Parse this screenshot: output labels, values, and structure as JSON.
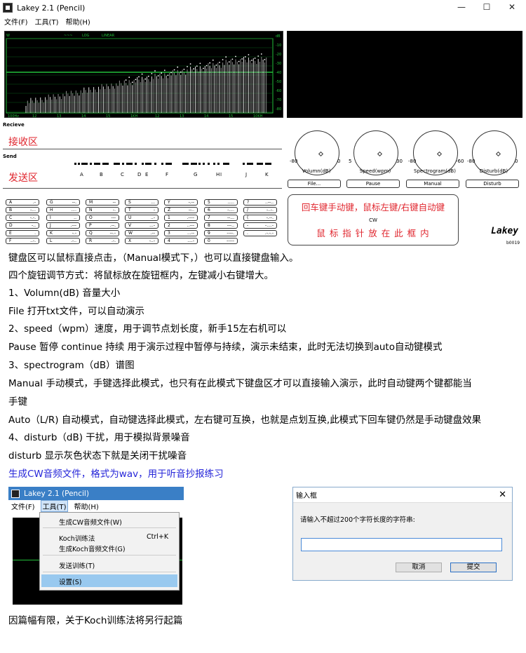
{
  "window": {
    "title": "Lakey 2.1 (Pencil)",
    "minimize": "—",
    "maximize": "☐",
    "close": "✕"
  },
  "menu": [
    "文件(F)",
    "工具(T)",
    "帮助(H)"
  ],
  "spectrum": {
    "top_labels": [
      "W",
      "~~~",
      "LOG",
      "LINEAR"
    ],
    "db_ticks": [
      "dB",
      "-10",
      "-20",
      "-30",
      "-40",
      "-50",
      "-60",
      "-70",
      "-80"
    ],
    "freq_ticks": [
      "100Hz",
      "12",
      "13",
      "14",
      "15",
      "1KH",
      "12",
      "13",
      "14",
      "15",
      "10KH"
    ]
  },
  "receive_label": "Recieve",
  "receive_cn": "接收区",
  "send_label": "Send",
  "send_cn": "发送区",
  "send_letters": [
    "A",
    "B",
    "C",
    "D",
    "E",
    "F",
    "G",
    "H",
    "I",
    "J",
    "K"
  ],
  "knobs": [
    {
      "name": "Volumn(dB)",
      "min": "-80",
      "max": "0"
    },
    {
      "name": "Speed(wpm)",
      "min": "5",
      "max": "30"
    },
    {
      "name": "Spectrogram(dB)",
      "min": "-80",
      "max": "-60"
    },
    {
      "name": "Disturb(dB)",
      "min": "-80",
      "max": "0"
    }
  ],
  "buttons": [
    "File...",
    "Pause",
    "Manual",
    "Disturb"
  ],
  "keyboard": [
    [
      "A .-",
      "G --.",
      "M --",
      "S ...",
      "Y -.--",
      "5 .....",
      "? ..--.."
    ],
    [
      "B -...",
      "H ....",
      "N -.",
      "T -",
      "Z --..",
      "6 -....",
      "/ -..-."
    ],
    [
      "C -.-.",
      "I ..",
      "O ---",
      "U ..-",
      "1 .----",
      "7 --...",
      "( -.--."
    ],
    [
      "D -..",
      "J .---",
      "P .--.",
      "V ...-",
      "2 ..---",
      "8 ---..",
      "- -....-"
    ],
    [
      "E .",
      "K -.-",
      "Q --.-",
      "W .--",
      "3 ...--",
      "9 ----.",
      ". .-.-.-"
    ],
    [
      "F ..-.",
      "L .-..",
      "R .-.",
      "X -..-",
      "4 ....-",
      "0 -----",
      ""
    ]
  ],
  "cwbox": {
    "line1": "回车键手动键，鼠标左键/右键自动键",
    "cw": "CW",
    "line2": "鼠 标 指 针 放 在 此 框 内"
  },
  "brand": {
    "name": "Lakey",
    "build": "b0019"
  },
  "text_lines": [
    "键盘区可以鼠标直接点击，（Manual模式下，）也可以直接键盘输入。",
    "四个旋钮调节方式：将鼠标放在旋钮框内，左键减小右键增大。",
    "1、Volumn(dB) 音量大小",
    "File 打开txt文件，可以自动演示",
    "2、speed（wpm）速度，用于调节点划长度，新手15左右机可以",
    "Pause 暂停 continue 持续  用于演示过程中暂停与持续，演示未结束，此时无法切换到auto自动键模式",
    "3、spectrogram（dB）谱图",
    "Manual 手动模式，手键选择此模式，也只有在此模式下键盘区才可以直接输入演示，此时自动键两个键都能当",
    "手键",
    "Auto（L/R) 自动模式，自动键选择此模式，左右键可互换，也就是点划互换,此模式下回车键仍然是手动键盘效果",
    "4、disturb（dB) 干扰，用于模拟背景噪音",
    "disturb 显示灰色状态下就是关闭干扰噪音",
    "生成CW音频文件，格式为wav，用于听音抄报练习"
  ],
  "tools_menu": {
    "title": "Lakey 2.1 (Pencil)",
    "menu": [
      "文件(F)",
      "工具(T)",
      "帮助(H)"
    ],
    "items": [
      {
        "label": "生成CW音频文件(W)",
        "shortcut": ""
      },
      {
        "label": "Koch训练法",
        "shortcut": "Ctrl+K"
      },
      {
        "label": "生成Koch音频文件(G)",
        "shortcut": ""
      },
      {
        "label": "发送训练(T)",
        "shortcut": ""
      },
      {
        "label": "设置(S)",
        "shortcut": ""
      }
    ]
  },
  "input_dialog": {
    "title": "输入框",
    "prompt": "请输入不超过200个字符长度的字符串:",
    "value": "",
    "cancel": "取消",
    "submit": "提交"
  },
  "footer": "因篇幅有限，关于Koch训练法将另行起篇",
  "colors": {
    "green": "#22c03a",
    "red": "#e0262e",
    "blue": "#2626d9",
    "menu_highlight": "#99c9ef"
  }
}
